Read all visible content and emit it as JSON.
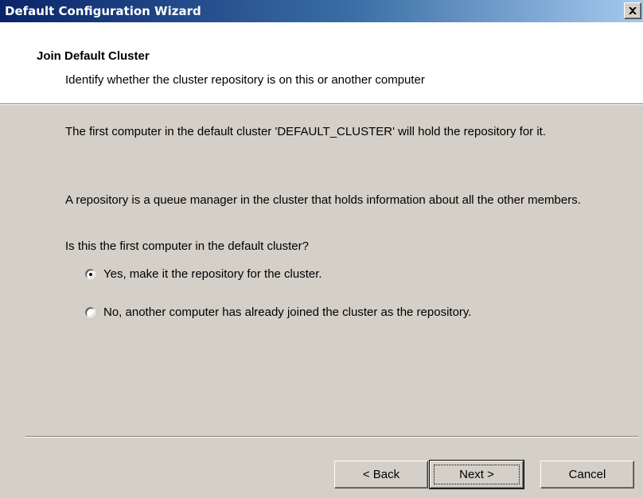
{
  "window": {
    "title": "Default Configuration Wizard",
    "close_icon": "close-icon"
  },
  "header": {
    "title": "Join Default Cluster",
    "subtitle": "Identify whether the cluster repository is on this or another computer"
  },
  "body": {
    "paragraph1": "The first computer in the default cluster 'DEFAULT_CLUSTER' will hold the repository for it.",
    "paragraph2": "A repository is a queue manager in the cluster that holds information about all the other members.",
    "question": "Is this the first computer in the default cluster?"
  },
  "options": [
    {
      "label": "Yes, make it the repository for the cluster.",
      "selected": true
    },
    {
      "label": "No, another computer has already joined the cluster as the repository.",
      "selected": false
    }
  ],
  "buttons": {
    "back": "< Back",
    "next": "Next >",
    "cancel": "Cancel"
  },
  "colors": {
    "titlebar_start": "#0a246a",
    "titlebar_end": "#a6caf0",
    "dialog_face": "#d4d0c8",
    "header_bg": "#ffffff"
  }
}
